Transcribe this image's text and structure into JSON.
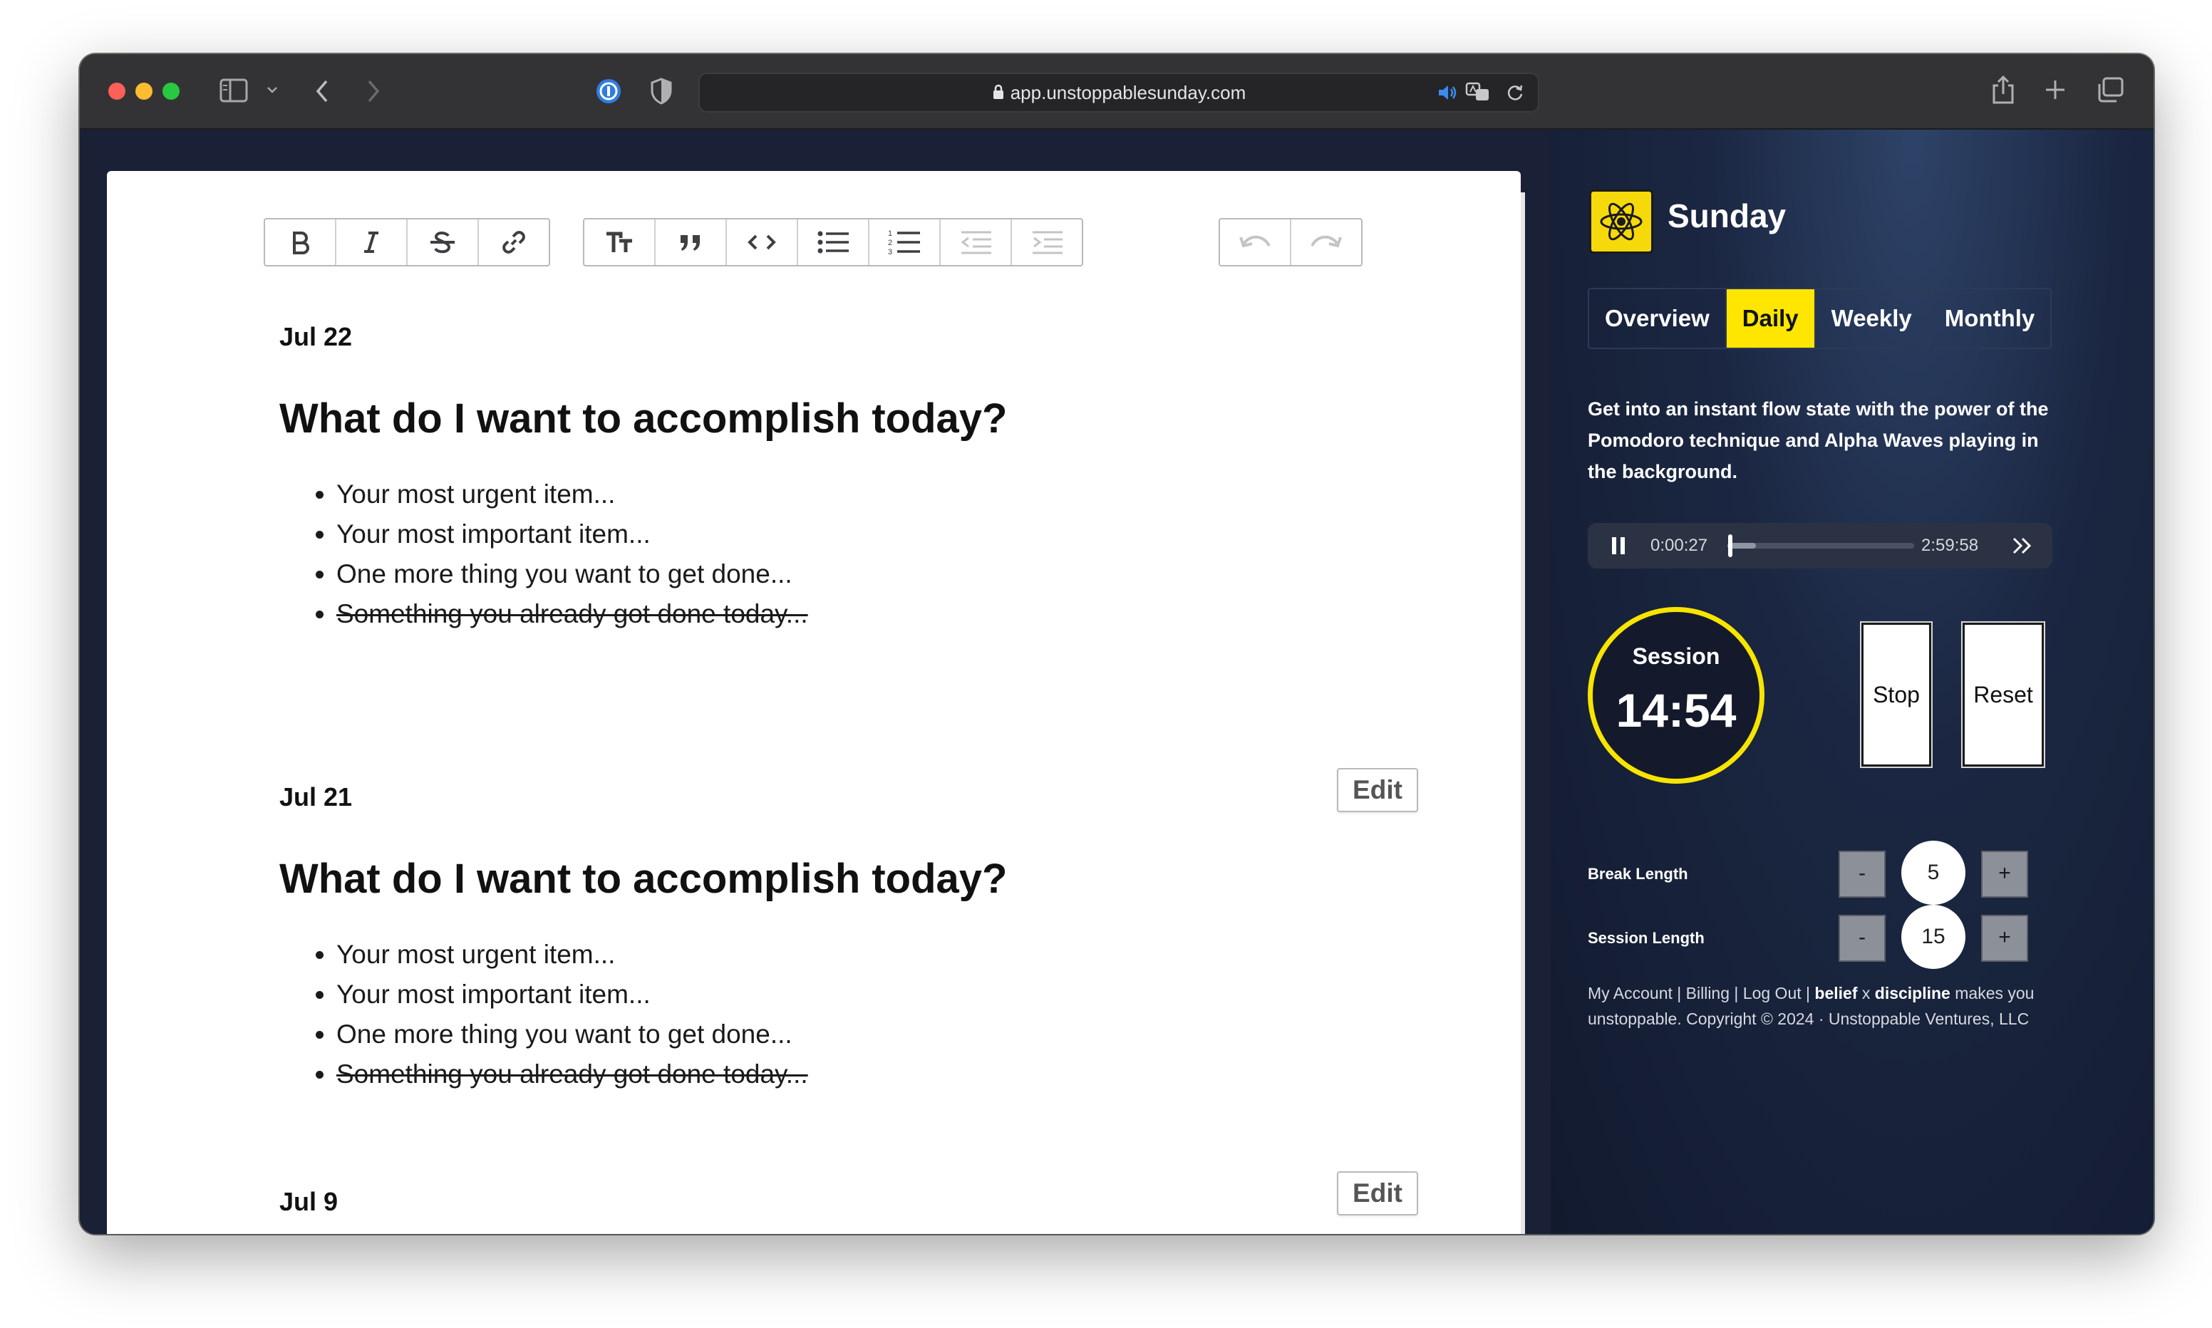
{
  "browser": {
    "url": "app.unstoppablesunday.com"
  },
  "editor": {
    "entries": [
      {
        "date": "Jul 22",
        "heading": "What do I want to accomplish today?",
        "items": [
          "Your most urgent item...",
          "Your most important item...",
          "One more thing you want to get done...",
          "Something you already got done today..."
        ]
      },
      {
        "date": "Jul 21",
        "edit_label": "Edit",
        "heading": "What do I want to accomplish today?",
        "items": [
          "Your most urgent item...",
          "Your most important item...",
          "One more thing you want to get done...",
          "Something you already got done today..."
        ]
      },
      {
        "date": "Jul 9",
        "edit_label": "Edit"
      }
    ]
  },
  "sidebar": {
    "brand": "Sunday",
    "tabs": [
      "Overview",
      "Daily",
      "Weekly",
      "Monthly"
    ],
    "active_tab": "Daily",
    "description": "Get into an instant flow state with the power of the Pomodoro technique and Alpha Waves playing in the background.",
    "player": {
      "current_time": "0:00:27",
      "duration": "2:59:58",
      "progress": 0.003
    },
    "session": {
      "label": "Session",
      "time": "14:54"
    },
    "stop_label": "Stop",
    "reset_label": "Reset",
    "break_length": {
      "label": "Break Length",
      "value": "5",
      "minus": "-",
      "plus": "+"
    },
    "session_length": {
      "label": "Session Length",
      "value": "15",
      "minus": "-",
      "plus": "+"
    },
    "footer": {
      "my_account": "My Account",
      "sep": " | ",
      "billing": "Billing",
      "log_out": "Log Out",
      "belief": "belief",
      "x": " x ",
      "discipline": "discipline",
      "tail": " makes you unstoppable. Copyright © 2024 · Unstoppable Ventures, LLC"
    }
  },
  "colors": {
    "accent_yellow": "#ffe600",
    "sidebar_bg": "#151b2e"
  }
}
